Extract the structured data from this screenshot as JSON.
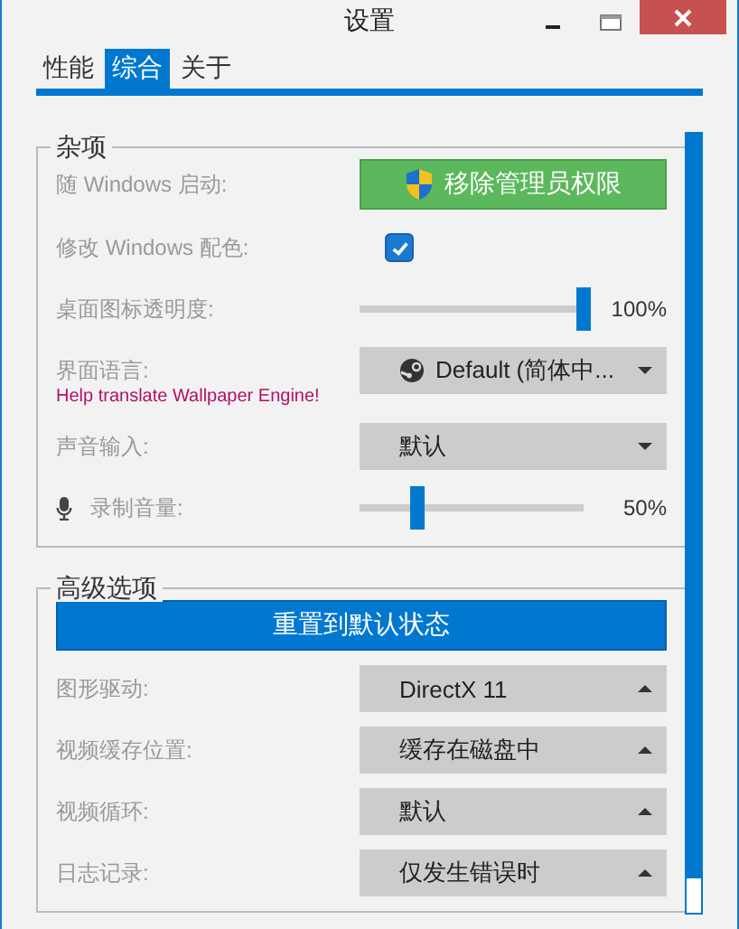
{
  "window": {
    "title": "设置"
  },
  "tabs": [
    {
      "label": "性能",
      "selected": false
    },
    {
      "label": "综合",
      "selected": true
    },
    {
      "label": "关于",
      "selected": false
    }
  ],
  "sections": [
    {
      "title": "杂项",
      "rows": [
        {
          "kind": "admin_button",
          "label": "随 Windows 启动:",
          "text": "移除管理员权限"
        },
        {
          "kind": "checkbox",
          "label": "修改 Windows 配色:",
          "checked": true
        },
        {
          "kind": "slider",
          "label": "桌面图标透明度:",
          "level": 1,
          "reading": "100%",
          "mic": false
        },
        {
          "kind": "dropdown",
          "label": "界面语言:",
          "value": "Default (简体中...",
          "steam": true,
          "link": "Help translate Wallpaper Engine!"
        },
        {
          "kind": "dropdown",
          "label": "声音输入:",
          "value": "默认",
          "steam": false
        },
        {
          "kind": "slider",
          "label": "录制音量:",
          "level": 0.26,
          "reading": "50%",
          "mic": true
        }
      ]
    },
    {
      "title": "高级选项",
      "rows": [
        {
          "kind": "wide_button",
          "text": "重置到默认状态"
        },
        {
          "kind": "dropup",
          "label": "图形驱动:",
          "value": "DirectX 11",
          "steam": false
        },
        {
          "kind": "dropup",
          "label": "视频缓存位置:",
          "value": "缓存在磁盘中",
          "steam": false
        },
        {
          "kind": "dropup",
          "label": "视频循环:",
          "value": "默认",
          "steam": false
        },
        {
          "kind": "dropup",
          "label": "日志记录:",
          "value": "仅发生错误时",
          "steam": false
        }
      ]
    }
  ]
}
